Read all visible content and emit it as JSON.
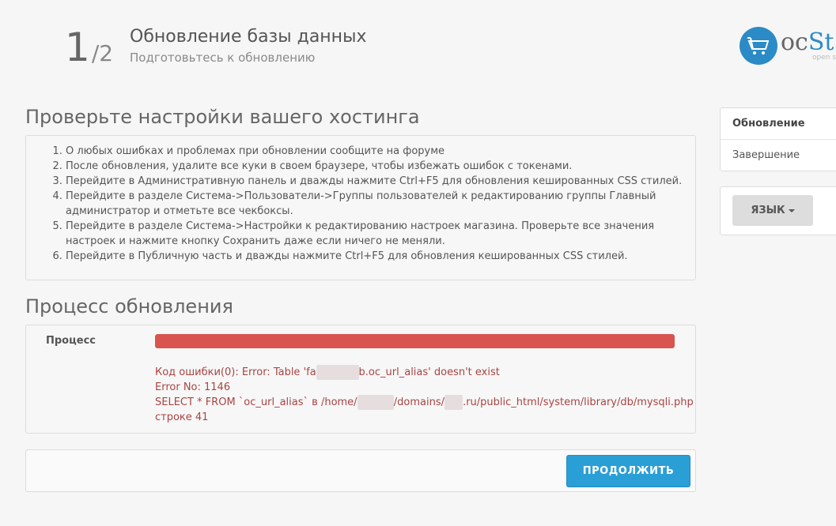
{
  "header": {
    "step_current": "1",
    "step_total": "/2",
    "title": "Обновление базы данных",
    "subtitle": "Подготовьтесь к обновлению"
  },
  "logo": {
    "text_prefix": "oc",
    "text_accent": "St",
    "subtext": "open s",
    "icon": "cart-icon"
  },
  "instructions": {
    "title": "Проверьте настройки вашего хостинга",
    "items": [
      "О любых ошибках и проблемах при обновлении сообщите на форуме",
      "После обновления, удалите все куки в своем браузере, чтобы избежать ошибок с токенами.",
      "Перейдите в Административную панель и дважды нажмите Ctrl+F5 для обновления кешированных CSS стилей.",
      "Перейдите в разделе Система->Пользователи->Группы пользователей к редактированию группы Главный администратор и отметьте все чекбоксы.",
      "Перейдите в разделе Система->Настройки к редактированию настроек магазина. Проверьте все значения настроек и нажмите кнопку Сохранить даже если ничего не меняли.",
      "Перейдите в Публичную часть и дважды нажмите Ctrl+F5 для обновления кешированных CSS стилей."
    ]
  },
  "process": {
    "title": "Процесс обновления",
    "label": "Процесс",
    "progress": 1.0,
    "progress_color": "#d9534f",
    "error_line1_a": "Код ошибки(0): Error: Table 'fa",
    "error_line1_b": "b.oc_url_alias' doesn't exist",
    "error_line2": "Error No: 1146",
    "error_line3_a": "SELECT * FROM `oc_url_alias` в /home/",
    "error_line3_b": "/domains/",
    "error_line3_c": ".ru/public_html/system/library/db/mysqli.php",
    "error_line4": "строке 41"
  },
  "footer": {
    "continue_label": "ПРОДОЛЖИТЬ"
  },
  "sidebar": {
    "steps": [
      {
        "label": "Обновление",
        "active": true
      },
      {
        "label": "Завершение",
        "active": false
      }
    ],
    "language_label": "ЯЗЫК"
  },
  "colors": {
    "accent": "#2a9fd6",
    "error": "#a94442",
    "progress_error": "#d9534f"
  }
}
